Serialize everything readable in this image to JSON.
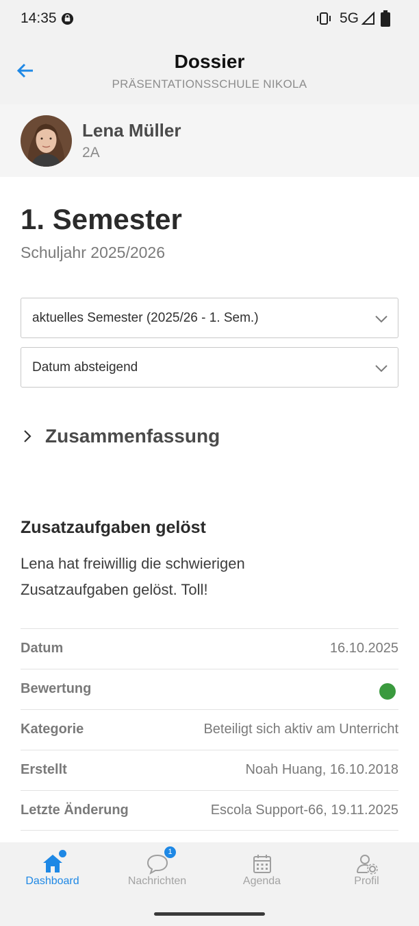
{
  "status_bar": {
    "time": "14:35",
    "network": "5G",
    "icons": [
      "notification-icon",
      "vibrate-icon",
      "signal-icon",
      "battery-icon"
    ]
  },
  "app_bar": {
    "title": "Dossier",
    "subtitle": "PRÄSENTATIONSSCHULE NIKOLA",
    "back_icon": "arrow-left-icon"
  },
  "student": {
    "name": "Lena Müller",
    "class": "2A"
  },
  "semester": {
    "title": "1. Semester",
    "school_year": "Schuljahr 2025/2026"
  },
  "filters": {
    "semester_select": "aktuelles Semester (2025/26 - 1. Sem.)",
    "sort_select": "Datum absteigend"
  },
  "summary": {
    "label": "Zusammenfassung"
  },
  "entry": {
    "title": "Zusatzaufgaben gelöst",
    "text": "Lena hat freiwillig die schwierigen Zusatzaufgaben gelöst. Toll!",
    "rows": [
      {
        "key": "Datum",
        "value": "16.10.2025"
      },
      {
        "key": "Bewertung",
        "rating_color": "#3a9a3e"
      },
      {
        "key": "Kategorie",
        "value": "Beteiligt sich aktiv am Unterricht"
      },
      {
        "key": "Erstellt",
        "value": "Noah Huang, 16.10.2018"
      },
      {
        "key": "Letzte Änderung",
        "value": "Escola Support-66, 19.11.2025"
      }
    ]
  },
  "tabs": [
    {
      "label": "Dashboard",
      "icon": "home-icon",
      "active": true
    },
    {
      "label": "Nachrichten",
      "icon": "chat-bubble-icon",
      "badge": "1"
    },
    {
      "label": "Agenda",
      "icon": "calendar-icon"
    },
    {
      "label": "Profil",
      "icon": "user-settings-icon"
    }
  ],
  "colors": {
    "accent": "#1e88e5",
    "rating_good": "#3a9a3e"
  }
}
